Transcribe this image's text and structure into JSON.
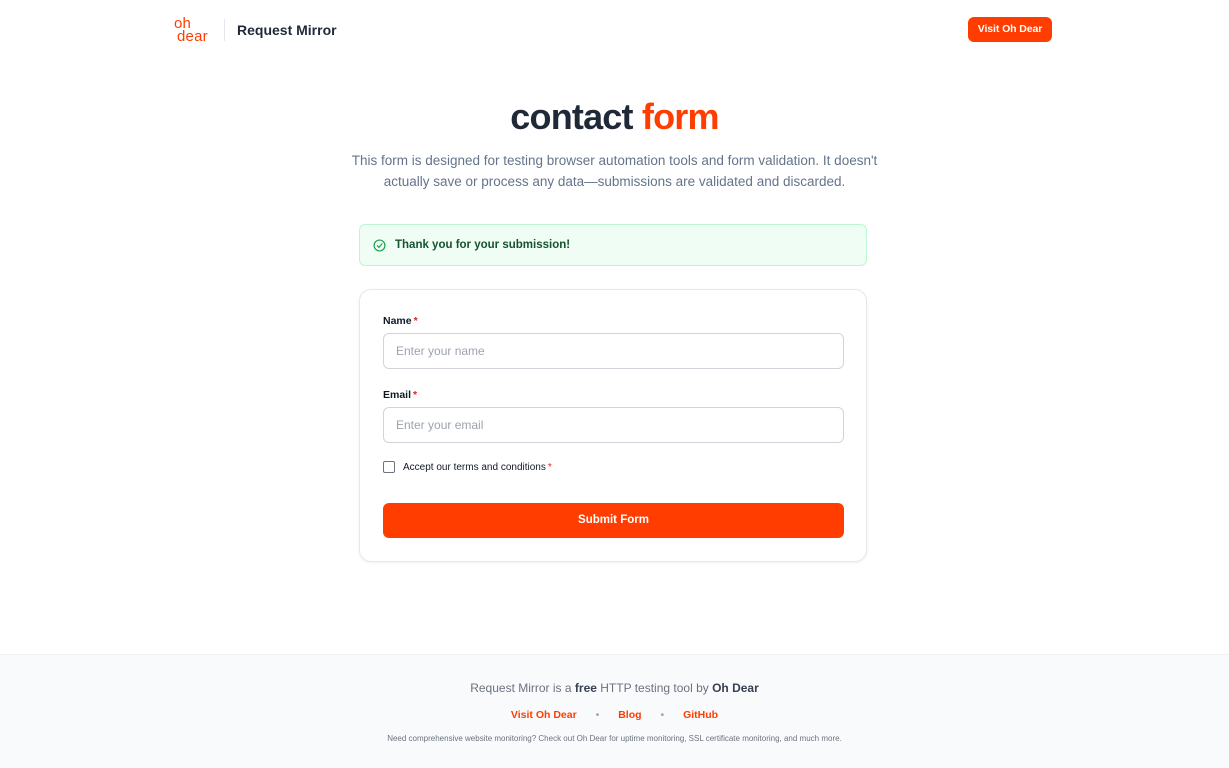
{
  "header": {
    "logo_line1": "oh",
    "logo_line2": "dear",
    "app_name": "Request Mirror",
    "visit_button": "Visit Oh Dear"
  },
  "hero": {
    "title_main": "contact",
    "title_accent": "form",
    "subtitle": "This form is designed for testing browser automation tools and form validation. It doesn't actually save or process any data—submissions are validated and discarded."
  },
  "alert": {
    "message": "Thank you for your submission!",
    "icon": "check-circle-icon",
    "color": "#16a34a"
  },
  "form": {
    "name_label": "Name",
    "name_placeholder": "Enter your name",
    "email_label": "Email",
    "email_placeholder": "Enter your email",
    "required_marker": "*",
    "terms_label": "Accept our terms and conditions",
    "terms_checked": false,
    "submit_label": "Submit Form"
  },
  "footer": {
    "line1_prefix": "Request Mirror is a ",
    "line1_free": "free",
    "line1_middle": " HTTP testing tool by ",
    "line1_brand": "Oh Dear",
    "links": [
      "Visit Oh Dear",
      "Blog",
      "GitHub"
    ],
    "separator": "•",
    "note": "Need comprehensive website monitoring? Check out Oh Dear for uptime monitoring, SSL certificate monitoring, and much more."
  },
  "colors": {
    "accent": "#ff3d00",
    "text_dark": "#1f2937",
    "success_bg": "#f0fdf4",
    "success_text": "#14532d"
  }
}
